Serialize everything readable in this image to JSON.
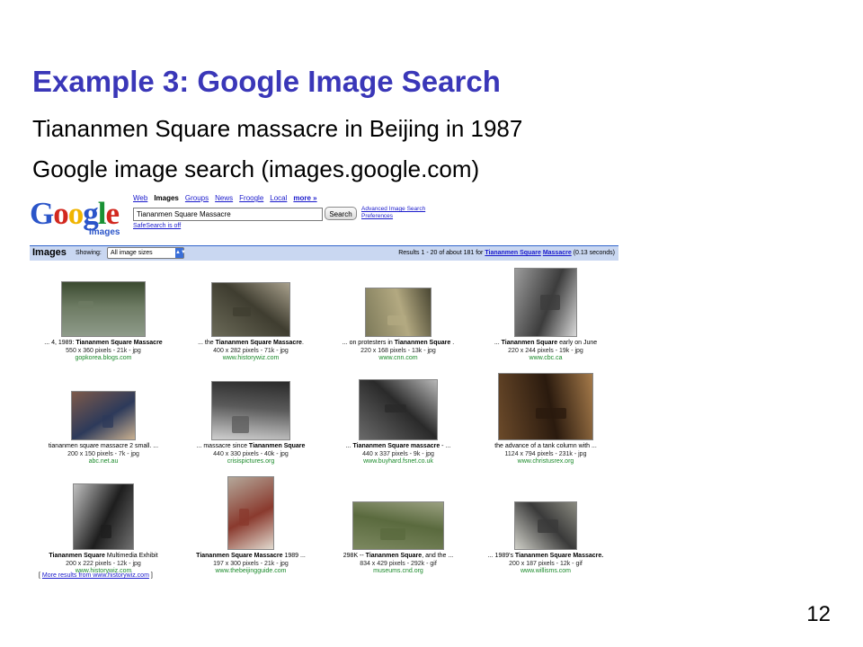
{
  "slide": {
    "title": "Example 3: Google Image Search",
    "line1": "Tiananmen Square massacre in Beijing in 1987",
    "line2": "Google image search (images.google.com)",
    "page_number": "12"
  },
  "google": {
    "logo_text": "Google",
    "logo_sub": "Images",
    "tabs": [
      "Web",
      "Images",
      "Groups",
      "News",
      "Froogle",
      "Local",
      "more »"
    ],
    "active_tab": "Images",
    "query": "Tiananmen Square Massacre",
    "search_button": "Search",
    "advanced_link": "Advanced Image Search",
    "preferences_link": "Preferences",
    "safesearch": "SafeSearch is off"
  },
  "results_bar": {
    "title": "Images",
    "showing_label": "Showing:",
    "size_option": "All image sizes",
    "results_prefix": "Results 1 - 20 of about 181 for",
    "query_link_1": "Tiananmen Square",
    "query_link_2": "Massacre",
    "results_suffix": "(0.13 seconds)"
  },
  "results": [
    {
      "pre": "... 4, 1989: ",
      "bold": "Tiananmen Square Massacre",
      "post": "",
      "meta": "550 x 360 pixels - 21k - jpg",
      "site": "gopkorea.blogs.com",
      "palette": [
        "#8e9b8a",
        "#6d7b63",
        "#3b4a30"
      ]
    },
    {
      "pre": "... the ",
      "bold": "Tiananmen Square Massacre",
      "post": ".",
      "meta": "400 x 282 pixels - 71k - jpg",
      "site": "www.historywiz.com",
      "palette": [
        "#6b6a58",
        "#3f3d30",
        "#a8a08c"
      ]
    },
    {
      "pre": "... on protesters in ",
      "bold": "Tiananmen Square",
      "post": " .",
      "meta": "220 x 168 pixels - 13k - jpg",
      "site": "www.cnn.com",
      "palette": [
        "#7d7a5a",
        "#b3a981",
        "#4a4733"
      ]
    },
    {
      "pre": "... ",
      "bold": "Tiananmen Square",
      "post": " early on June",
      "meta": "220 x 244 pixels - 19k - jpg",
      "site": "www.cbc.ca",
      "palette": [
        "#9b9b9b",
        "#3c3c3c",
        "#d8d8d8"
      ]
    },
    {
      "pre": "tiananmen square massacre",
      "bold": "",
      "post": " 2 small. ...",
      "meta": "200 x 150 pixels - 7k - jpg",
      "site": "abc.net.au",
      "palette": [
        "#7d5a4a",
        "#2d3a5a",
        "#c9b090"
      ]
    },
    {
      "pre": "... massacre since ",
      "bold": "Tiananmen Square",
      "post": "",
      "meta": "440 x 330 pixels - 40k - jpg",
      "site": "crisispictures.org",
      "palette": [
        "#cfcfcf",
        "#5a5a5a",
        "#2a2a2a"
      ]
    },
    {
      "pre": "... ",
      "bold": "Tiananmen Square massacre",
      "post": " - ...",
      "meta": "440 x 337 pixels - 9k - jpg",
      "site": "www.buyhard.fsnet.co.uk",
      "palette": [
        "#6a6a6a",
        "#2a2a2a",
        "#b8b8b8"
      ]
    },
    {
      "pre": "the advance of a tank column with ...",
      "bold": "",
      "post": "",
      "meta": "1124 x 794 pixels - 231k - jpg",
      "site": "www.christusrex.org",
      "palette": [
        "#6b4a2a",
        "#2a1a0e",
        "#a57a4a"
      ]
    },
    {
      "pre": "",
      "bold": "Tiananmen Square",
      "post": " Multimedia Exhibit",
      "meta": "200 x 222 pixels - 12k - jpg",
      "site": "www.historywiz.com",
      "palette": [
        "#c0c0c0",
        "#1e1e1e",
        "#707070"
      ]
    },
    {
      "pre": "",
      "bold": "Tiananmen Square Massacre",
      "post": " 1989 ...",
      "meta": "197 x 300 pixels - 21k - jpg",
      "site": "www.thebeijingguide.com",
      "palette": [
        "#b4a89a",
        "#8a3a2e",
        "#e2dbd0"
      ]
    },
    {
      "pre": "298K -- ",
      "bold": "Tiananmen Square",
      "post": ", and the ...",
      "meta": "834 x 429 pixels - 292k - gif",
      "site": "museums.cnd.org",
      "palette": [
        "#7c8860",
        "#5a6a3e",
        "#9aa080"
      ]
    },
    {
      "pre": "... 1989's ",
      "bold": "Tiananmen Square Massacre.",
      "post": "",
      "meta": "200 x 187 pixels - 12k - gif",
      "site": "www.willisms.com",
      "palette": [
        "#d0d0c8",
        "#3a3a3a",
        "#8a8a80"
      ]
    }
  ],
  "more_results": "More results from www.historywiz.com"
}
